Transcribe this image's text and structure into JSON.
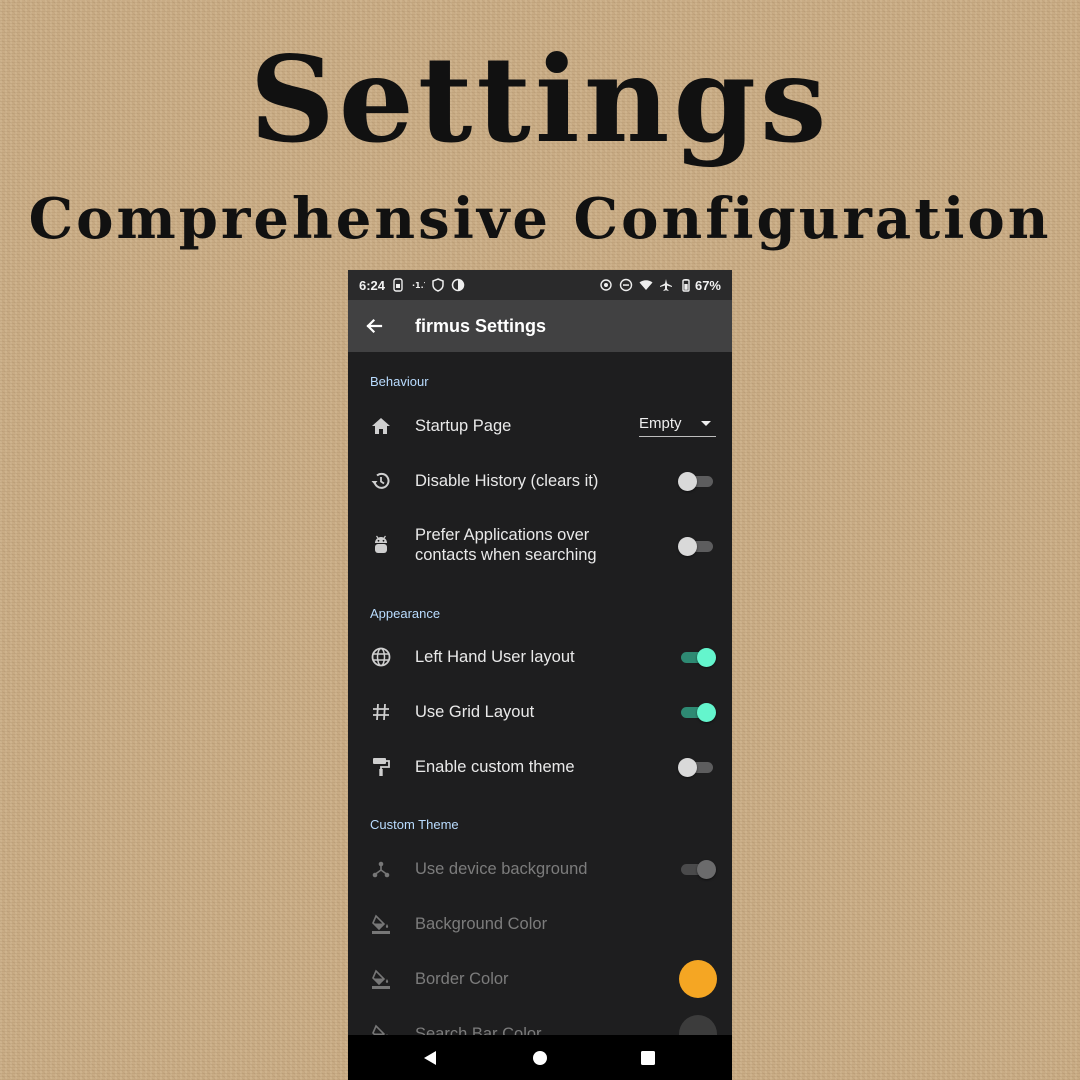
{
  "banner": {
    "title": "Settings",
    "subtitle": "Comprehensive Configuration"
  },
  "status_bar": {
    "time": "6:24",
    "battery": "67%"
  },
  "app_bar": {
    "title": "firmus Settings"
  },
  "sections": {
    "behaviour": "Behaviour",
    "appearance": "Appearance",
    "custom_theme": "Custom Theme"
  },
  "settings": {
    "startup_page": {
      "label": "Startup Page",
      "value": "Empty",
      "icon": "home-icon"
    },
    "disable_history": {
      "label": "Disable History (clears it)",
      "checked": false,
      "icon": "history-icon"
    },
    "prefer_apps": {
      "label": "Prefer Applications over contacts when searching",
      "checked": false,
      "icon": "android-icon"
    },
    "left_hand": {
      "label": "Left Hand User layout",
      "checked": true,
      "icon": "globe-icon"
    },
    "grid_layout": {
      "label": "Use Grid Layout",
      "checked": true,
      "icon": "hashtag-icon"
    },
    "custom_theme": {
      "label": "Enable custom theme",
      "checked": false,
      "icon": "paint-roller-icon"
    },
    "device_background": {
      "label": "Use device background",
      "checked": true,
      "enabled": false,
      "icon": "share-hub-icon"
    },
    "background_color": {
      "label": "Background Color",
      "enabled": false,
      "icon": "fill-bucket-icon"
    },
    "border_color": {
      "label": "Border Color",
      "enabled": false,
      "color": "#f5a623",
      "icon": "fill-bucket-icon"
    },
    "search_bar_color": {
      "label": "Search Bar Color",
      "enabled": false,
      "color": "#3c3c3c",
      "icon": "fill-bucket-icon"
    }
  },
  "colors": {
    "accent": "#64f5cd",
    "section_header": "#b9dcff",
    "background": "#1e1e1f",
    "app_bar": "#414142"
  }
}
